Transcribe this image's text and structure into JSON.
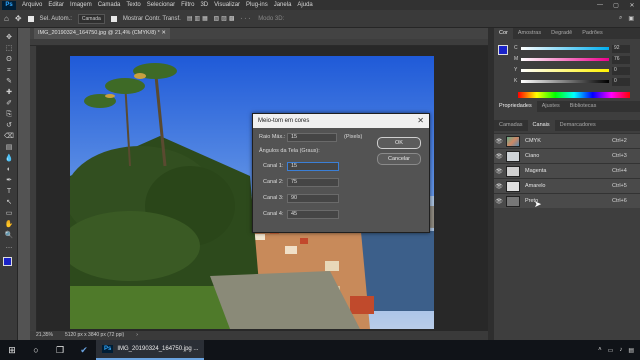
{
  "app": {
    "logo": "Ps"
  },
  "menu": [
    "Arquivo",
    "Editar",
    "Imagem",
    "Camada",
    "Texto",
    "Selecionar",
    "Filtro",
    "3D",
    "Visualizar",
    "Plug-ins",
    "Janela",
    "Ajuda"
  ],
  "window_controls": [
    "—",
    "▢",
    "✕"
  ],
  "options_bar": {
    "auto_select_label": "Sel. Autom.:",
    "auto_select_value": "Camada",
    "show_transform": "Mostrar Contr. Transf.",
    "mode_3d": "Modo 3D:"
  },
  "document": {
    "tab_title": "IMG_20190324_164750.jpg @ 21,4% (CMYK/8) *",
    "zoom": "21,35%",
    "doc_size": "5120 px x 3840 px (72 ppi)"
  },
  "tools": [
    "move-icon",
    "marquee-icon",
    "lasso-icon",
    "crop-icon",
    "eyedropper-icon",
    "healing-icon",
    "brush-icon",
    "stamp-icon",
    "history-brush-icon",
    "eraser-icon",
    "gradient-icon",
    "blur-icon",
    "dodge-icon",
    "pen-icon",
    "type-icon",
    "path-select-icon",
    "shape-icon",
    "hand-icon",
    "zoom-icon",
    "more-icon"
  ],
  "tool_glyphs": [
    "✥",
    "⬚",
    "ʘ",
    "⌗",
    "✎",
    "✚",
    "✐",
    "⎘",
    "↺",
    "⌫",
    "▤",
    "💧",
    "◐",
    "✒",
    "T",
    "↖",
    "▭",
    "✋",
    "🔍",
    "…"
  ],
  "colors": {
    "foreground": "#1a23c8",
    "background": "#ffffff",
    "accent": "#31a8ff"
  },
  "color_panel": {
    "tabs": [
      "Cor",
      "Amostras",
      "Degradê",
      "Padrões"
    ],
    "sliders": [
      {
        "label": "C",
        "value": "92"
      },
      {
        "label": "M",
        "value": "76"
      },
      {
        "label": "Y",
        "value": "0"
      },
      {
        "label": "K",
        "value": "0"
      }
    ]
  },
  "props_tabs": [
    "Propriedades",
    "Ajustes",
    "Bibliotecas"
  ],
  "layers_tabs": [
    "Camadas",
    "Canais",
    "Demarcadores"
  ],
  "channels": [
    {
      "name": "CMYK",
      "shortcut": "Ctrl+2"
    },
    {
      "name": "Ciano",
      "shortcut": "Ctrl+3"
    },
    {
      "name": "Magenta",
      "shortcut": "Ctrl+4"
    },
    {
      "name": "Amarelo",
      "shortcut": "Ctrl+5"
    },
    {
      "name": "Preto",
      "shortcut": "Ctrl+6"
    }
  ],
  "dialog": {
    "title": "Meio-tom em cores",
    "raio_label": "Raio Máx.:",
    "raio_value": "15",
    "raio_unit": "(Pixels)",
    "angles_label": "Ângulos da Tela (Graus):",
    "canals": [
      {
        "label": "Canal 1:",
        "value": "15"
      },
      {
        "label": "Canal 2:",
        "value": "75"
      },
      {
        "label": "Canal 3:",
        "value": "90"
      },
      {
        "label": "Canal 4:",
        "value": "45"
      }
    ],
    "ok": "OK",
    "cancel": "Cancelar"
  },
  "taskbar": {
    "app_label": "IMG_20190324_164750.jpg ...",
    "time": ""
  }
}
